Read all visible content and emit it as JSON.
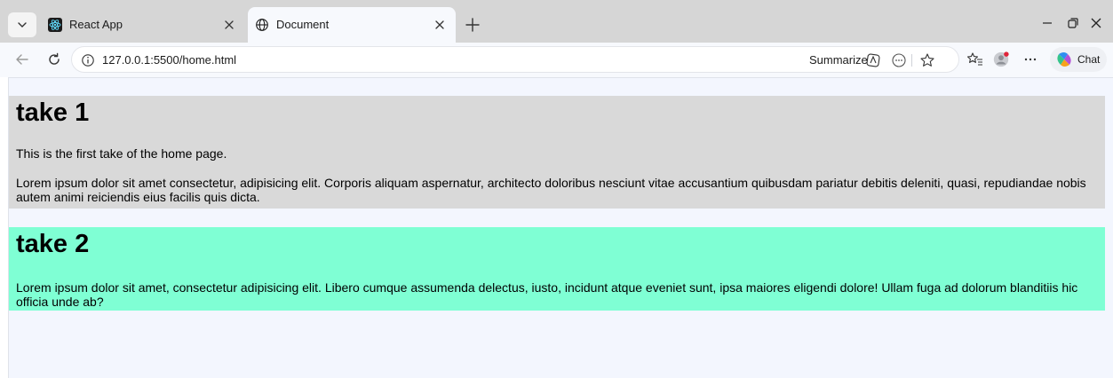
{
  "browser": {
    "tabs": [
      {
        "title": "React App",
        "favicon": "react-logo-icon",
        "active": false
      },
      {
        "title": "Document",
        "favicon": "globe-icon",
        "active": true
      }
    ],
    "url": "127.0.0.1:5500/home.html",
    "summarize_label": "Summarize",
    "chat_label": "Chat",
    "colors": {
      "tabstrip": "#d6d6d6",
      "toolbar": "#f7f9fd",
      "notification_dot": "#e0243a"
    }
  },
  "page": {
    "background": "#f3f6fe",
    "sections": [
      {
        "heading": "take 1",
        "background": "#d9d9d9",
        "paragraphs": [
          "This is the first take of the home page.",
          "Lorem ipsum dolor sit amet consectetur, adipisicing elit. Corporis aliquam aspernatur, architecto doloribus nesciunt vitae accusantium quibusdam pariatur debitis deleniti, quasi, repudiandae nobis autem animi reiciendis eius facilis quis dicta."
        ]
      },
      {
        "heading": "take 2",
        "background": "#7fffd4",
        "paragraphs": [
          "Lorem ipsum dolor sit amet, consectetur adipisicing elit. Libero cumque assumenda delectus, iusto, incidunt atque eveniet sunt, ipsa maiores eligendi dolore! Ullam fuga ad dolorum blanditiis hic officia unde ab?"
        ]
      }
    ]
  }
}
